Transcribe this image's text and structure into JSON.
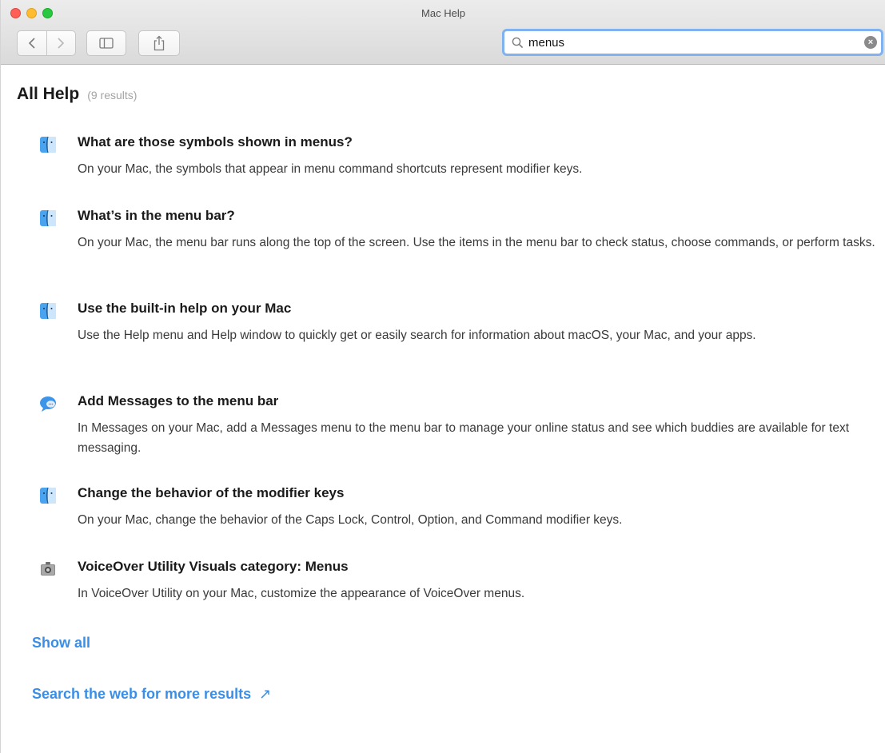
{
  "window": {
    "title": "Mac Help"
  },
  "toolbar": {
    "back_icon": "chevron-left-icon",
    "forward_icon": "chevron-right-icon",
    "sidebar_icon": "sidebar-icon",
    "share_icon": "share-icon"
  },
  "search": {
    "value": "menus",
    "icon": "magnifying-glass-icon",
    "clear_icon": "clear-circle-icon"
  },
  "results_header": {
    "title": "All Help",
    "count": "(9 results)"
  },
  "results": [
    {
      "icon": "finder-icon",
      "title": "What are those symbols shown in menus?",
      "description": "On your Mac, the symbols that appear in menu command shortcuts represent modifier keys."
    },
    {
      "icon": "finder-icon",
      "title": "What’s in the menu bar?",
      "description": "On your Mac, the menu bar runs along the top of the screen. Use the items in the menu bar to check status, choose commands, or perform tasks."
    },
    {
      "icon": "finder-icon",
      "title": "Use the built-in help on your Mac",
      "description": "Use the Help menu and Help window to quickly get or easily search for information about macOS, your Mac, and your apps."
    },
    {
      "icon": "messages-icon",
      "title": "Add Messages to the menu bar",
      "description": "In Messages on your Mac, add a Messages menu to the menu bar to manage your online status and see which buddies are available for text messaging."
    },
    {
      "icon": "finder-icon",
      "title": "Change the behavior of the modifier keys",
      "description": "On your Mac, change the behavior of the Caps Lock, Control, Option, and Command modifier keys."
    },
    {
      "icon": "voiceover-utility-icon",
      "title": "VoiceOver Utility Visuals category: Menus",
      "description": "In VoiceOver Utility on your Mac, customize the appearance of VoiceOver menus."
    }
  ],
  "links": {
    "show_all": "Show all",
    "search_web": "Search the web for more results",
    "search_web_icon": "arrow-up-right-icon"
  },
  "colors": {
    "accent_link": "#3a8ee6",
    "search_focus": "#7fb2ee",
    "close": "#fe5f57",
    "minimize": "#febc2e",
    "maximize": "#28c840"
  }
}
